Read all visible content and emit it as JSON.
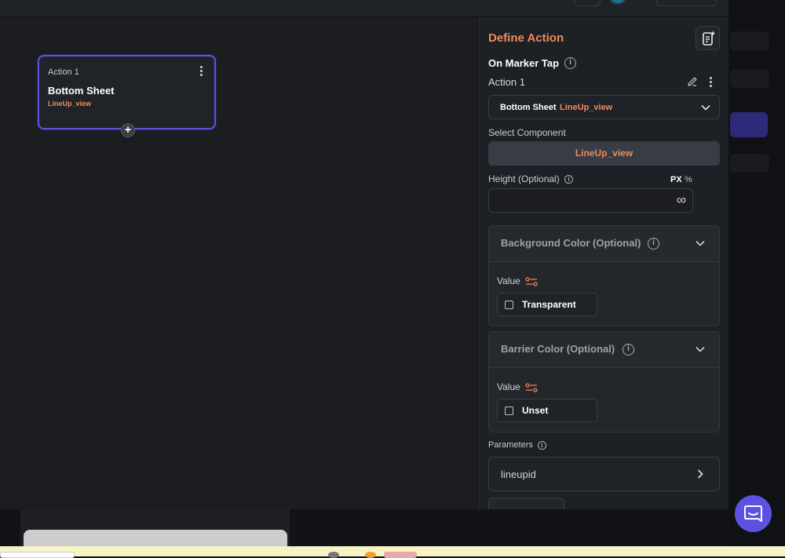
{
  "canvas": {
    "node": {
      "header": "Action 1",
      "title": "Bottom Sheet",
      "component": "LineUp_view"
    }
  },
  "panel": {
    "title": "Define Action",
    "trigger": "On Marker Tap",
    "action_label": "Action 1",
    "action_select": {
      "type": "Bottom Sheet",
      "component": "LineUp_view"
    },
    "select_component_label": "Select Component",
    "component_button": "LineUp_view",
    "height": {
      "label": "Height (Optional)",
      "unit_px": "PX",
      "unit_pct": "%",
      "value": "∞"
    },
    "background_color": {
      "title": "Background Color (Optional)",
      "value_label": "Value",
      "option": "Transparent"
    },
    "barrier_color": {
      "title": "Barrier Color (Optional)",
      "value_label": "Value",
      "option": "Unset"
    },
    "parameters": {
      "label": "Parameters",
      "items": [
        "lineupid"
      ]
    }
  },
  "colors": {
    "accent": "#f08a5d",
    "selection": "#5b53e0",
    "panel_bg": "#1d2024",
    "canvas_bg": "#1b1d21"
  },
  "icons": {
    "doc": "note-add-icon",
    "edit": "pencil-icon",
    "more": "kebab-menu-icon",
    "expand": "chevron-down-icon",
    "navigate": "chevron-right-icon",
    "chat": "chat-bubble-icon"
  }
}
